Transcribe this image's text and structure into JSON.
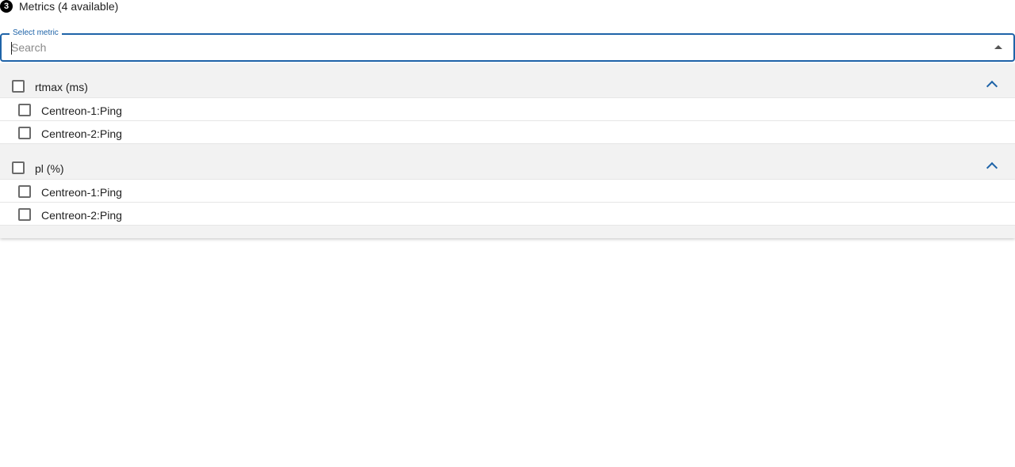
{
  "step": {
    "number": "3",
    "title": "Metrics (4 available)"
  },
  "select": {
    "label": "Select metric",
    "placeholder": "Search",
    "value": "",
    "icon": "arrow-drop-up-icon"
  },
  "groups": [
    {
      "label": "rtmax (ms)",
      "expanded": true,
      "items": [
        {
          "label": "Centreon-1:Ping"
        },
        {
          "label": "Centreon-2:Ping"
        }
      ]
    },
    {
      "label": "pl (%)",
      "expanded": true,
      "items": [
        {
          "label": "Centreon-1:Ping"
        },
        {
          "label": "Centreon-2:Ping"
        }
      ]
    }
  ],
  "colors": {
    "accent": "#1e63a8",
    "group_background": "#f2f2f2",
    "badge": "#000000"
  }
}
